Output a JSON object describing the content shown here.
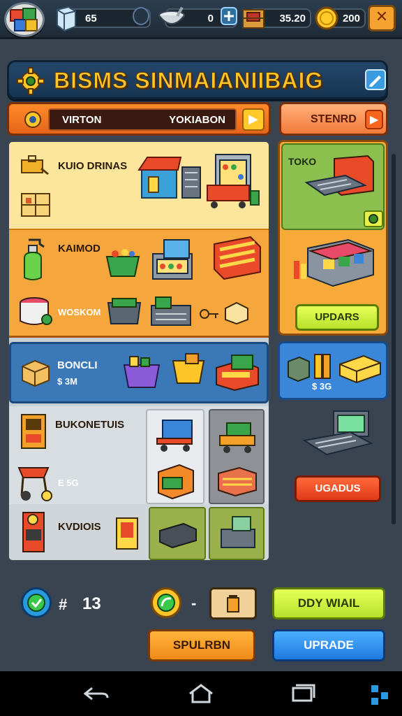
{
  "topbar": {
    "resources": [
      {
        "icon": "ice-cube-icon",
        "value": "65"
      },
      {
        "icon": "bowl-icon",
        "value": "0"
      },
      {
        "icon": "crate-icon",
        "value": "35.20"
      },
      {
        "icon": "coin-icon",
        "value": "200"
      }
    ],
    "close_label": "✕"
  },
  "title": {
    "text": "BISMS SINMAIANIIBAIG",
    "gear_icon": "gear-icon",
    "edit_icon": "pencil-icon"
  },
  "filter": {
    "left_text": "VIRTON",
    "right_text": "YOKIABON",
    "arrow": "▶"
  },
  "stand_button": {
    "label": "STENRD",
    "arrow": "▶"
  },
  "categories": {
    "yellow": {
      "label": "KUIO DRINAS"
    },
    "orange": {
      "label": "KAIMOD",
      "sub_label": "WOSKOM"
    },
    "blue": {
      "label": "BONCLI",
      "sub_label": "$ 3M"
    },
    "grey": {
      "label": "BUKONETUIS",
      "sub_label": "E 5G"
    },
    "grey2": {
      "label": "KVDIOIS"
    }
  },
  "right_panel": {
    "toko_label": "TOKO",
    "upgrade_label": "UPDARS",
    "blue_price": "$ 3G",
    "red_button": "UGADUS"
  },
  "bottom": {
    "count_prefix": "#",
    "count_value": "13",
    "dash": "-",
    "buy_label": "DDY WIAIL",
    "orange_label": "SPULRBN",
    "upgrade_label": "UPRADE"
  },
  "colors": {
    "title_yellow": "#ffc62a",
    "lime": "#c8ef3a",
    "red": "#e8401c",
    "orange": "#f5a63c",
    "blue": "#3a78b8"
  }
}
